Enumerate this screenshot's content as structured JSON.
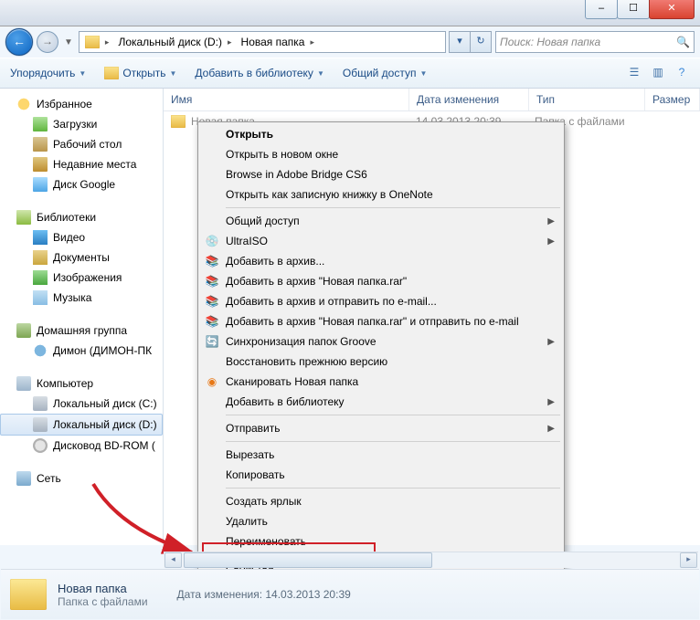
{
  "titlebar": {},
  "nav": {
    "crumb_drive": "Локальный диск (D:)",
    "crumb_folder": "Новая папка",
    "search_placeholder": "Поиск: Новая папка"
  },
  "toolbar": {
    "organize": "Упорядочить",
    "open": "Открыть",
    "addlib": "Добавить в библиотеку",
    "share": "Общий доступ"
  },
  "columns": {
    "name": "Имя",
    "date": "Дата изменения",
    "type": "Тип",
    "size": "Размер"
  },
  "row": {
    "name": "Новая папка",
    "date": "14.03.2013 20:39",
    "type": "Папка с файлами"
  },
  "sidebar": {
    "fav": "Избранное",
    "fav_items": [
      "Загрузки",
      "Рабочий стол",
      "Недавние места",
      "Диск Google"
    ],
    "lib": "Библиотеки",
    "lib_items": [
      "Видео",
      "Документы",
      "Изображения",
      "Музыка"
    ],
    "home": "Домашняя группа",
    "home_items": [
      "Димон (ДИМОН-ПК"
    ],
    "comp": "Компьютер",
    "comp_items": [
      "Локальный диск (C:)",
      "Локальный диск (D:)",
      "Дисковод BD-ROM ("
    ],
    "net": "Сеть"
  },
  "context": {
    "open": "Открыть",
    "open_new": "Открыть в новом окне",
    "bridge": "Browse in Adobe Bridge CS6",
    "onenote": "Открыть как записную книжку в OneNote",
    "share": "Общий доступ",
    "ultraiso": "UltraISO",
    "addarc": "Добавить в архив...",
    "addrar": "Добавить в архив \"Новая папка.rar\"",
    "addemail": "Добавить в архив и отправить по e-mail...",
    "addraremail": "Добавить в архив \"Новая папка.rar\" и отправить по e-mail",
    "groove": "Синхронизация папок Groove",
    "restore": "Восстановить прежнюю версию",
    "scan": "Сканировать Новая папка",
    "addlib": "Добавить в библиотеку",
    "send": "Отправить",
    "cut": "Вырезать",
    "copy": "Копировать",
    "shortcut": "Создать ярлык",
    "delete": "Удалить",
    "rename": "Переименовать",
    "props": "Свойства"
  },
  "details": {
    "name": "Новая папка",
    "type": "Папка с файлами",
    "meta": "Дата изменения: 14.03.2013 20:39"
  }
}
